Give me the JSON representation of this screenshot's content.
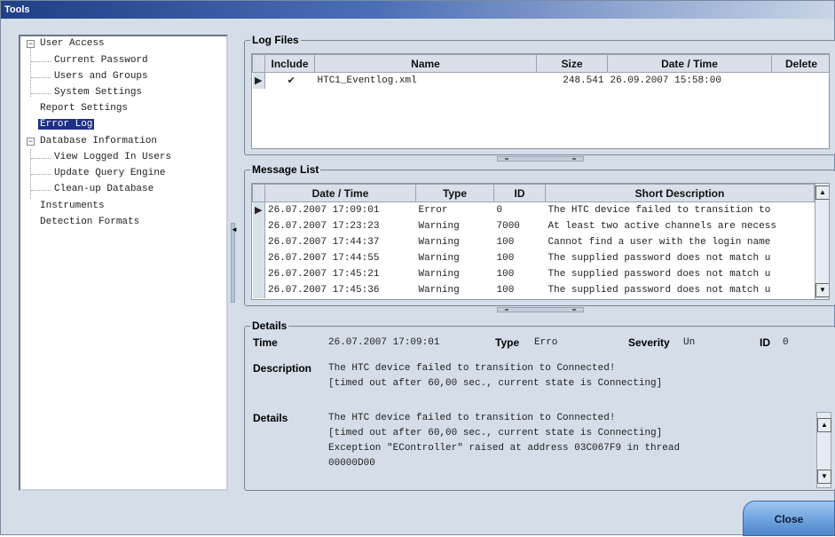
{
  "window": {
    "title": "Tools"
  },
  "tree": {
    "items": [
      {
        "label": "User Access",
        "level": 0,
        "expander": "-"
      },
      {
        "label": "Current Password",
        "level": 1
      },
      {
        "label": "Users and Groups",
        "level": 1
      },
      {
        "label": "System Settings",
        "level": 1
      },
      {
        "label": "Report Settings",
        "level": 0
      },
      {
        "label": "Error Log",
        "level": 0,
        "selected": true
      },
      {
        "label": "Database Information",
        "level": 0,
        "expander": "-"
      },
      {
        "label": "View Logged In Users",
        "level": 1
      },
      {
        "label": "Update Query Engine",
        "level": 1
      },
      {
        "label": "Clean-up Database",
        "level": 1
      },
      {
        "label": "Instruments",
        "level": 0
      },
      {
        "label": "Detection Formats",
        "level": 0
      }
    ]
  },
  "log_files": {
    "title": "Log Files",
    "columns": {
      "include": "Include",
      "name": "Name",
      "size": "Size",
      "datetime": "Date / Time",
      "delete": "Delete"
    },
    "rows": [
      {
        "include": "✔",
        "name": "HTC1_Eventlog.xml",
        "size": "248.541",
        "datetime": "26.09.2007 15:58:00",
        "delete": ""
      }
    ]
  },
  "message_list": {
    "title": "Message List",
    "columns": {
      "datetime": "Date / Time",
      "type": "Type",
      "id": "ID",
      "desc": "Short Description"
    },
    "rows": [
      {
        "datetime": "26.07.2007 17:09:01",
        "type": "Error",
        "id": "0",
        "desc": "The HTC device failed to transition to"
      },
      {
        "datetime": "26.07.2007 17:23:23",
        "type": "Warning",
        "id": "7000",
        "desc": "At least two active channels are necess"
      },
      {
        "datetime": "26.07.2007 17:44:37",
        "type": "Warning",
        "id": "100",
        "desc": "Cannot find a user with the login name"
      },
      {
        "datetime": "26.07.2007 17:44:55",
        "type": "Warning",
        "id": "100",
        "desc": "The supplied password does not match u"
      },
      {
        "datetime": "26.07.2007 17:45:21",
        "type": "Warning",
        "id": "100",
        "desc": "The supplied password does not match u"
      },
      {
        "datetime": "26.07.2007 17:45:36",
        "type": "Warning",
        "id": "100",
        "desc": "The supplied password does not match u"
      }
    ]
  },
  "details": {
    "title": "Details",
    "time_label": "Time",
    "time_value": "26.07.2007 17:09:01",
    "type_label": "Type",
    "type_value": "Erro",
    "severity_label": "Severity",
    "severity_value": "Un",
    "id_label": "ID",
    "id_value": "0",
    "description_label": "Description",
    "description_lines": [
      "The HTC device failed to transition to Connected!",
      "[timed out after 60,00 sec., current state is Connecting]"
    ],
    "details_label": "Details",
    "details_lines": [
      "The HTC device failed to transition to Connected!",
      "[timed out after 60,00 sec., current state is Connecting]",
      "Exception \"EController\" raised at address 03C067F9 in thread",
      "00000D00"
    ]
  },
  "buttons": {
    "close": "Close"
  },
  "icons": {
    "scroll_up": "▲",
    "scroll_down": "▼",
    "row_pointer": "▶",
    "grip_left": "◄"
  },
  "colors": {
    "selection": "#1f2f86",
    "title_bar": "#1f3f86",
    "close_button": "#6ea2de"
  }
}
